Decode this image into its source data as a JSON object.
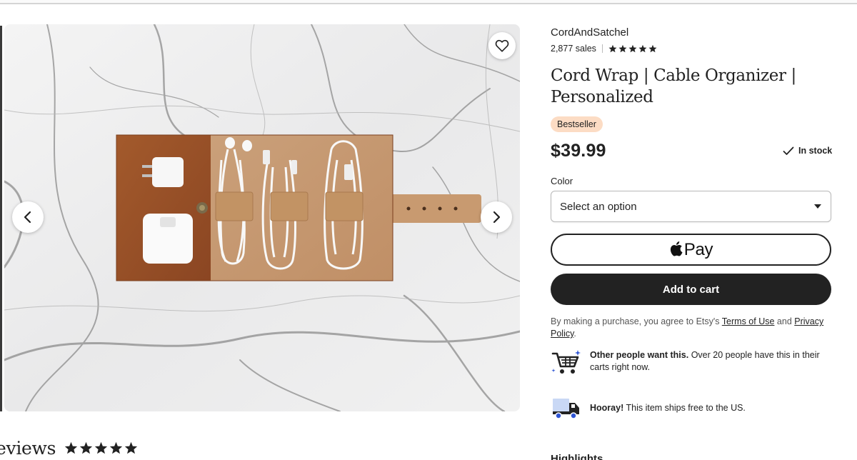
{
  "listing": {
    "shop_name": "CordAndSatchel",
    "sales_count": "2,877 sales",
    "shop_rating_stars": 5,
    "title": "Cord Wrap | Cable Organizer | Personalized",
    "badge": "Bestseller",
    "price": "$39.99",
    "stock_status": "In stock"
  },
  "variation": {
    "label": "Color",
    "selected": "Select an option"
  },
  "buttons": {
    "pay_label": "Pay",
    "add_to_cart": "Add to cart"
  },
  "legal": {
    "prefix": "By making a purchase, you agree to Etsy's ",
    "terms_link": "Terms of Use",
    "conjunction": " and ",
    "privacy_link": "Privacy Policy",
    "suffix": "."
  },
  "promos": [
    {
      "icon": "cart-sparkle-icon",
      "bold": "Other people want this.",
      "text": " Over 20 people have this in their carts right now."
    },
    {
      "icon": "delivery-truck-icon",
      "bold": "Hooray!",
      "text": " This item ships free to the US."
    }
  ],
  "reviews": {
    "title": "eviews",
    "rating_stars": 5
  },
  "highlights_heading": "Highlights",
  "icons": {
    "favorite": "heart-icon",
    "prev": "chevron-left-icon",
    "next": "chevron-right-icon",
    "select": "caret-down-icon",
    "stock": "checkmark-icon",
    "apple": "apple-logo-icon"
  },
  "colors": {
    "primary_button": "#222222",
    "badge_bg": "#fcdcc4",
    "text": "#222222"
  }
}
